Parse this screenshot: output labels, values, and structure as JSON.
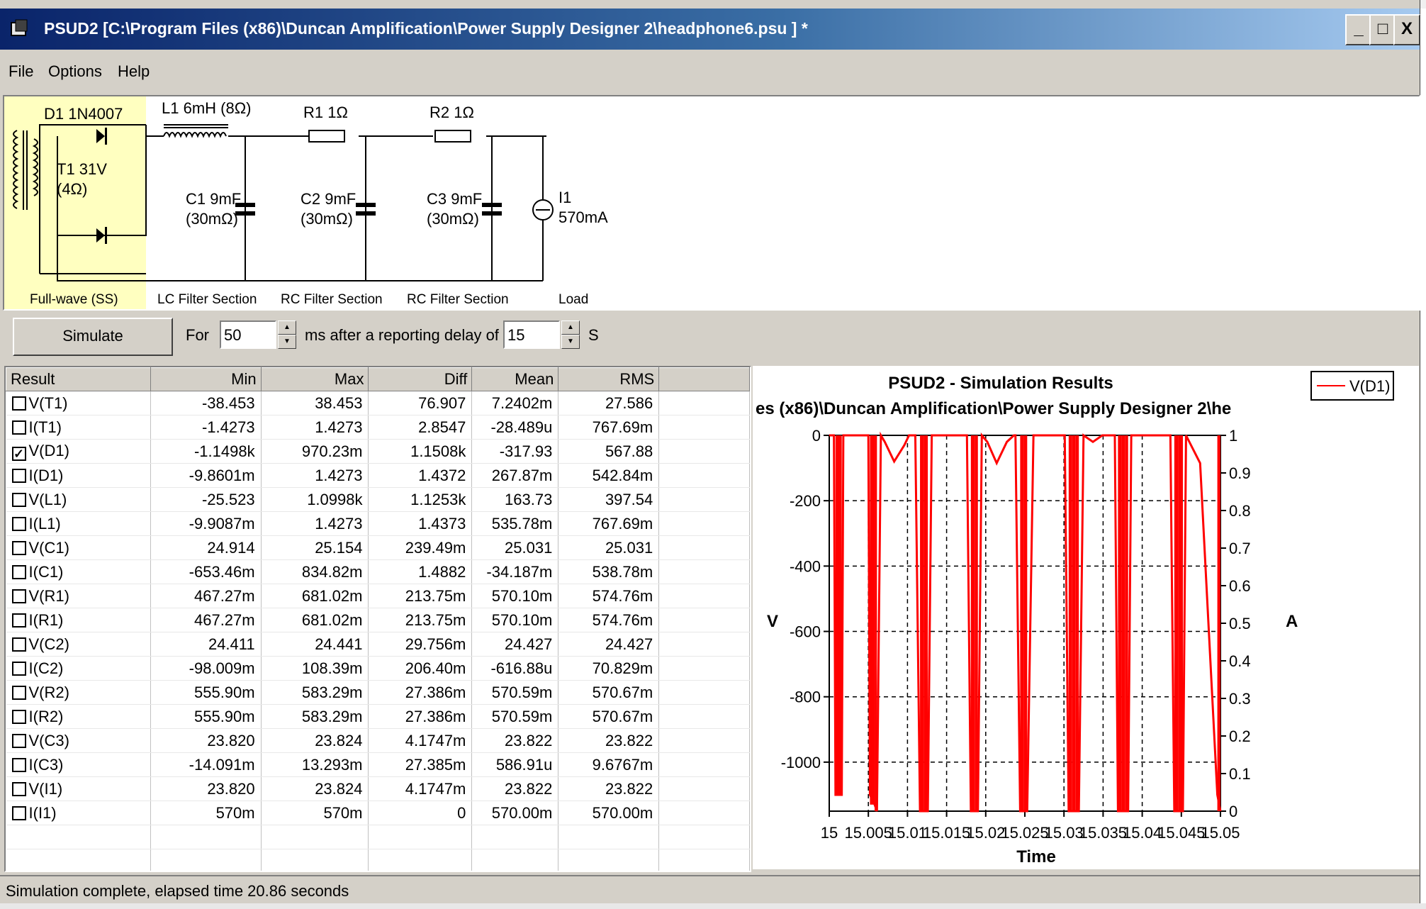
{
  "window": {
    "title": "PSUD2  [C:\\Program Files (x86)\\Duncan Amplification\\Power Supply Designer 2\\headphone6.psu ] *",
    "minimize_label": "_",
    "maximize_label": "□",
    "close_label": "X"
  },
  "menu": {
    "items": [
      "File",
      "Options",
      "Help"
    ]
  },
  "schematic": {
    "rectifier_label": "D1 1N4007",
    "transformer_label": "T1 31V",
    "transformer_res": "(4Ω)",
    "inductor_label": "L1 6mH (8Ω)",
    "r1_label": "R1 1Ω",
    "r2_label": "R2 1Ω",
    "c1_label": "C1 9mF",
    "c1_esr": "(30mΩ)",
    "c2_label": "C2 9mF",
    "c2_esr": "(30mΩ)",
    "c3_label": "C3 9mF",
    "c3_esr": "(30mΩ)",
    "i1_label": "I1",
    "i1_value": "570mA",
    "sections": [
      "Full-wave (SS)",
      "LC Filter Section",
      "RC Filter Section",
      "RC Filter Section",
      "Load"
    ],
    "rectifier_fill": "#ffffc0"
  },
  "toolbar": {
    "simulate_label": "Simulate",
    "for_label": "For",
    "duration_value": "50",
    "ms_label": "ms  after a reporting delay of",
    "delay_value": "15",
    "s_label": "S"
  },
  "results": {
    "columns": [
      "Result",
      "Min",
      "Max",
      "Diff",
      "Mean",
      "RMS"
    ],
    "rows": [
      {
        "name": "V(T1)",
        "checked": false,
        "min": "-38.453",
        "max": "38.453",
        "diff": "76.907",
        "mean": "7.2402m",
        "rms": "27.586"
      },
      {
        "name": "I(T1)",
        "checked": false,
        "min": "-1.4273",
        "max": "1.4273",
        "diff": "2.8547",
        "mean": "-28.489u",
        "rms": "767.69m"
      },
      {
        "name": "V(D1)",
        "checked": true,
        "min": "-1.1498k",
        "max": "970.23m",
        "diff": "1.1508k",
        "mean": "-317.93",
        "rms": "567.88"
      },
      {
        "name": "I(D1)",
        "checked": false,
        "min": "-9.8601m",
        "max": "1.4273",
        "diff": "1.4372",
        "mean": "267.87m",
        "rms": "542.84m"
      },
      {
        "name": "V(L1)",
        "checked": false,
        "min": "-25.523",
        "max": "1.0998k",
        "diff": "1.1253k",
        "mean": "163.73",
        "rms": "397.54"
      },
      {
        "name": "I(L1)",
        "checked": false,
        "min": "-9.9087m",
        "max": "1.4273",
        "diff": "1.4373",
        "mean": "535.78m",
        "rms": "767.69m"
      },
      {
        "name": "V(C1)",
        "checked": false,
        "min": "24.914",
        "max": "25.154",
        "diff": "239.49m",
        "mean": "25.031",
        "rms": "25.031"
      },
      {
        "name": "I(C1)",
        "checked": false,
        "min": "-653.46m",
        "max": "834.82m",
        "diff": "1.4882",
        "mean": "-34.187m",
        "rms": "538.78m"
      },
      {
        "name": "V(R1)",
        "checked": false,
        "min": "467.27m",
        "max": "681.02m",
        "diff": "213.75m",
        "mean": "570.10m",
        "rms": "574.76m"
      },
      {
        "name": "I(R1)",
        "checked": false,
        "min": "467.27m",
        "max": "681.02m",
        "diff": "213.75m",
        "mean": "570.10m",
        "rms": "574.76m"
      },
      {
        "name": "V(C2)",
        "checked": false,
        "min": "24.411",
        "max": "24.441",
        "diff": "29.756m",
        "mean": "24.427",
        "rms": "24.427"
      },
      {
        "name": "I(C2)",
        "checked": false,
        "min": "-98.009m",
        "max": "108.39m",
        "diff": "206.40m",
        "mean": "-616.88u",
        "rms": "70.829m"
      },
      {
        "name": "V(R2)",
        "checked": false,
        "min": "555.90m",
        "max": "583.29m",
        "diff": "27.386m",
        "mean": "570.59m",
        "rms": "570.67m"
      },
      {
        "name": "I(R2)",
        "checked": false,
        "min": "555.90m",
        "max": "583.29m",
        "diff": "27.386m",
        "mean": "570.59m",
        "rms": "570.67m"
      },
      {
        "name": "V(C3)",
        "checked": false,
        "min": "23.820",
        "max": "23.824",
        "diff": "4.1747m",
        "mean": "23.822",
        "rms": "23.822"
      },
      {
        "name": "I(C3)",
        "checked": false,
        "min": "-14.091m",
        "max": "13.293m",
        "diff": "27.385m",
        "mean": "586.91u",
        "rms": "9.6767m"
      },
      {
        "name": "V(I1)",
        "checked": false,
        "min": "23.820",
        "max": "23.824",
        "diff": "4.1747m",
        "mean": "23.822",
        "rms": "23.822"
      },
      {
        "name": "I(I1)",
        "checked": false,
        "min": "570m",
        "max": "570m",
        "diff": "0",
        "mean": "570.00m",
        "rms": "570.00m"
      }
    ]
  },
  "chart_data": {
    "type": "line",
    "title": "PSUD2 - Simulation Results",
    "subtitle": "es (x86)\\Duncan Amplification\\Power Supply Designer 2\\he",
    "xlabel": "Time",
    "ylabel": "V",
    "y2label": "A",
    "xlim": [
      15,
      15.05
    ],
    "ylim": [
      -1150,
      0
    ],
    "y2lim": [
      0,
      1
    ],
    "x_ticks": [
      "15",
      "15.005",
      "15.01",
      "15.015",
      "15.02",
      "15.025",
      "15.03",
      "15.035",
      "15.04",
      "15.045",
      "15.05"
    ],
    "y_ticks": [
      0,
      -200,
      -400,
      -600,
      -800,
      -1000
    ],
    "y_tick_labels": [
      "0",
      "-200",
      "-400",
      "-600",
      "-800",
      "-1000"
    ],
    "y2_ticks": [
      1,
      0.9,
      0.8,
      0.7,
      0.6,
      0.5,
      0.4,
      0.3,
      0.2,
      0.1,
      0
    ],
    "y2_tick_labels": [
      "1",
      "0.9",
      "0.8",
      "0.7",
      "0.6",
      "0.5",
      "0.4",
      "0.3",
      "0.2",
      "0.1",
      "0"
    ],
    "grid": true,
    "legend_position": "top-right",
    "series": [
      {
        "name": "V(D1)",
        "color": "#ff0000",
        "x": [
          15.0,
          15.0006,
          15.0008,
          15.0016,
          15.0018,
          15.0022,
          15.005,
          15.0052,
          15.0058,
          15.0061,
          15.0066,
          15.0071,
          15.0083,
          15.0096,
          15.0102,
          15.011,
          15.0116,
          15.0121,
          15.0126,
          15.0131,
          15.0151,
          15.0176,
          15.0181,
          15.0186,
          15.019,
          15.0195,
          15.0202,
          15.0214,
          15.0227,
          15.0236,
          15.0238,
          15.0244,
          15.0249,
          15.0253,
          15.0261,
          15.0279,
          15.0301,
          15.0306,
          15.031,
          15.0315,
          15.0319,
          15.0325,
          15.0337,
          15.0349,
          15.0365,
          15.0369,
          15.0374,
          15.0378,
          15.0382,
          15.0386,
          15.0406,
          15.0436,
          15.0441,
          15.0446,
          15.0452,
          15.0456,
          15.0474,
          15.0496,
          15.05
        ],
        "y": [
          0,
          0,
          -1100,
          -1100,
          0,
          0,
          0,
          -1100,
          -1130,
          -1150,
          0,
          -20,
          -80,
          -30,
          0,
          0,
          -1150,
          -1150,
          -1150,
          0,
          0,
          0,
          -1150,
          -1150,
          -1150,
          0,
          -20,
          -85,
          -20,
          0,
          0,
          -1150,
          -1150,
          -1150,
          0,
          0,
          0,
          -1150,
          -1150,
          -1150,
          -1150,
          0,
          -20,
          0,
          0,
          -1150,
          -1150,
          -1150,
          -1150,
          0,
          0,
          0,
          -1150,
          -1150,
          -1150,
          0,
          -85,
          -1100,
          -1150
        ]
      }
    ]
  }
}
